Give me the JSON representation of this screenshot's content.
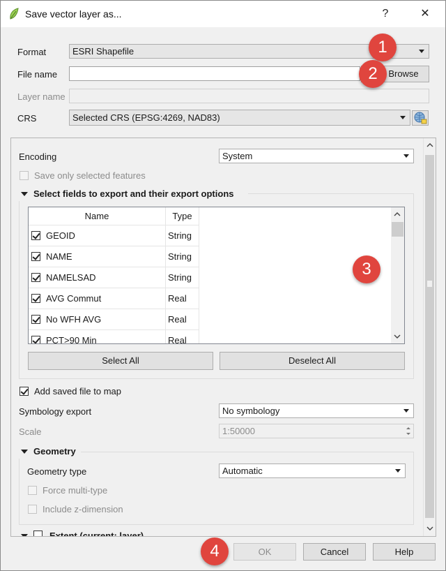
{
  "window": {
    "title": "Save vector layer as...",
    "help_label": "?",
    "close_label": "✕"
  },
  "format": {
    "label": "Format",
    "value": "ESRI Shapefile"
  },
  "file_name": {
    "label": "File name",
    "value": "",
    "browse_label": "Browse"
  },
  "layer_name": {
    "label": "Layer name",
    "value": ""
  },
  "crs": {
    "label": "CRS",
    "value": "Selected CRS (EPSG:4269, NAD83)"
  },
  "encoding": {
    "label": "Encoding",
    "value": "System"
  },
  "save_selected": {
    "label": "Save only selected features",
    "checked": false
  },
  "fields_group": {
    "title": "Select fields to export and their export options",
    "columns": [
      "Name",
      "Type"
    ],
    "rows": [
      {
        "name": "GEOID",
        "type": "String",
        "checked": true
      },
      {
        "name": "NAME",
        "type": "String",
        "checked": true
      },
      {
        "name": "NAMELSAD",
        "type": "String",
        "checked": true
      },
      {
        "name": "AVG Commut",
        "type": "Real",
        "checked": true
      },
      {
        "name": "No WFH AVG",
        "type": "Real",
        "checked": true
      },
      {
        "name": "PCT>90 Min",
        "type": "Real",
        "checked": true
      }
    ],
    "select_all_label": "Select All",
    "deselect_all_label": "Deselect All"
  },
  "add_to_map": {
    "label": "Add saved file to map",
    "checked": true
  },
  "symbology": {
    "label": "Symbology export",
    "value": "No symbology"
  },
  "scale": {
    "label": "Scale",
    "value": "1:50000"
  },
  "geometry_group": {
    "title": "Geometry",
    "type_label": "Geometry type",
    "type_value": "Automatic",
    "force_multi_label": "Force multi-type",
    "z_dimension_label": "Include z-dimension"
  },
  "extent_group": {
    "title": "Extent (current: layer)"
  },
  "buttons": {
    "ok": "OK",
    "cancel": "Cancel",
    "help": "Help"
  },
  "callouts": [
    "1",
    "2",
    "3",
    "4"
  ],
  "colors": {
    "callout": "#e0453e",
    "window_bg": "#f0f0f0"
  }
}
